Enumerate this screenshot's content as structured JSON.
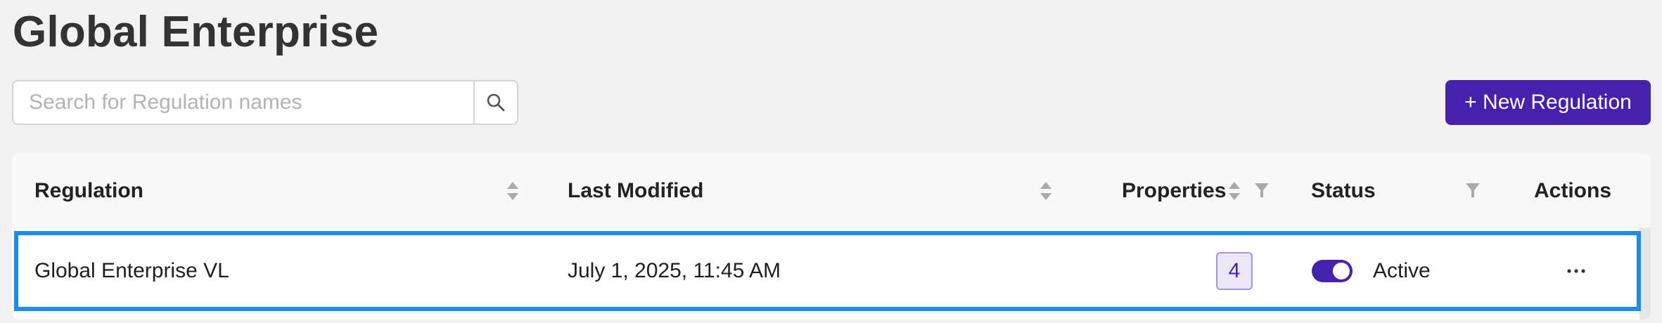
{
  "page": {
    "title": "Global Enterprise"
  },
  "search": {
    "placeholder": "Search for Regulation names",
    "value": ""
  },
  "toolbar": {
    "new_regulation_label": "+ New Regulation"
  },
  "table": {
    "columns": {
      "regulation": "Regulation",
      "last_modified": "Last Modified",
      "properties": "Properties",
      "status": "Status",
      "actions": "Actions"
    },
    "rows": [
      {
        "regulation": "Global Enterprise VL",
        "last_modified": "July 1, 2025, 11:45 AM",
        "properties": "4",
        "status": "Active",
        "status_on": true,
        "actions": "···"
      }
    ]
  },
  "colors": {
    "accent": "#4621ad",
    "selection_border": "#1a8cf0",
    "badge_bg": "#ece6f9",
    "page_bg": "#f2f2f2"
  },
  "icons": {
    "search": "search-icon",
    "sort": "sort-icon",
    "filter": "filter-icon",
    "more": "more-icon"
  }
}
